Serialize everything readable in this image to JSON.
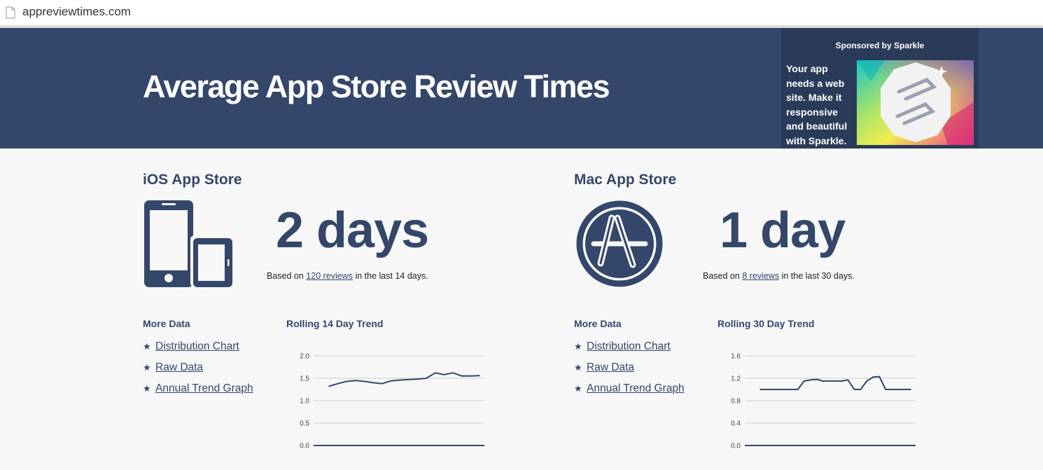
{
  "browser": {
    "url": "appreviewtimes.com"
  },
  "header": {
    "title": "Average App Store Review Times",
    "sponsor_label": "Sponsored by Sparkle",
    "sponsor_text": "Your app needs a web site. Make it responsive and beautiful with Sparkle."
  },
  "ios": {
    "title": "iOS App Store",
    "value": "2 days",
    "based_prefix": "Based on ",
    "reviews_link": "120 reviews",
    "based_suffix": " in the last 14 days.",
    "more_heading": "More Data",
    "links": [
      "Distribution Chart",
      "Raw Data",
      "Annual Trend Graph"
    ],
    "trend_heading": "Rolling 14 Day Trend"
  },
  "mac": {
    "title": "Mac App Store",
    "value": "1 day",
    "based_prefix": "Based on ",
    "reviews_link": "8 reviews",
    "based_suffix": " in the last 30 days.",
    "more_heading": "More Data",
    "links": [
      "Distribution Chart",
      "Raw Data",
      "Annual Trend Graph"
    ],
    "trend_heading": "Rolling 30 Day Trend"
  },
  "colors": {
    "primary": "#34476a",
    "background": "#f7f7f7",
    "grid": "#cccccc"
  },
  "chart_data": [
    {
      "type": "line",
      "title": "Rolling 14 Day Trend",
      "ylim": [
        0,
        2.0
      ],
      "yticks": [
        "2.0",
        "1.5",
        "1.0",
        "0.5",
        "0.0"
      ],
      "ytick_values": [
        2.0,
        1.5,
        1.0,
        0.5,
        0.0
      ],
      "values": [
        1.32,
        1.38,
        1.43,
        1.45,
        1.43,
        1.4,
        1.38,
        1.44,
        1.46,
        1.47,
        1.48,
        1.5,
        1.62,
        1.58,
        1.62,
        1.55,
        1.55,
        1.56
      ]
    },
    {
      "type": "line",
      "title": "Rolling 30 Day Trend",
      "ylim": [
        0,
        1.6
      ],
      "yticks": [
        "1.6",
        "1.2",
        "0.8",
        "0.4",
        "0.0"
      ],
      "ytick_values": [
        1.6,
        1.2,
        0.8,
        0.4,
        0.0
      ],
      "values": [
        1.0,
        1.0,
        1.0,
        1.0,
        1.0,
        1.0,
        1.0,
        1.15,
        1.17,
        1.18,
        1.15,
        1.15,
        1.15,
        1.15,
        1.17,
        1.0,
        1.0,
        1.15,
        1.22,
        1.23,
        1.0,
        1.0,
        1.0,
        1.0,
        1.0
      ]
    }
  ]
}
